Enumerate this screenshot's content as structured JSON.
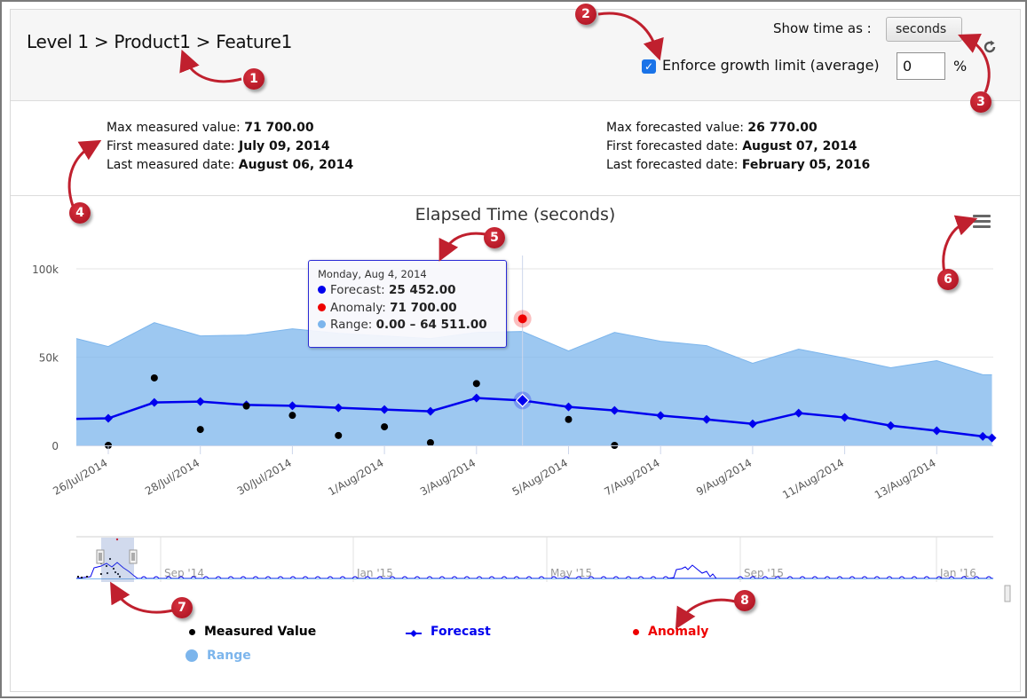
{
  "header": {
    "breadcrumb": [
      "Level 1",
      "Product1",
      "Feature1"
    ],
    "breadcrumb_separator": " > ",
    "show_time_label": "Show time as :",
    "time_unit_selected": "seconds",
    "refresh_icon": "refresh-icon",
    "growth_limit_checked": true,
    "growth_limit_label": "Enforce growth limit (average)",
    "growth_limit_value": "0",
    "percent_label": "%"
  },
  "stats": {
    "measured": [
      {
        "label": "Max measured value: ",
        "value": "71 700.00"
      },
      {
        "label": "First measured date: ",
        "value": "July 09, 2014"
      },
      {
        "label": "Last measured date: ",
        "value": "August 06, 2014"
      }
    ],
    "forecasted": [
      {
        "label": "Max forecasted value: ",
        "value": "26 770.00"
      },
      {
        "label": "First forecasted date: ",
        "value": "August 07, 2014"
      },
      {
        "label": "Last forecasted date: ",
        "value": "February 05, 2016"
      }
    ]
  },
  "tooltip": {
    "date": "Monday, Aug 4, 2014",
    "rows": [
      {
        "name": "Forecast",
        "value": "25 452.00",
        "color": "#0000ee"
      },
      {
        "name": "Anomaly",
        "value": "71 700.00",
        "color": "#ee0000"
      },
      {
        "name": "Range",
        "value": "0.00 – 64 511.00",
        "color": "#7cb5ec"
      }
    ]
  },
  "colors": {
    "range": "#7cb5ec",
    "forecast": "#0000ee",
    "measured": "#000000",
    "anomaly": "#ee0000"
  },
  "annotations": [
    "1",
    "2",
    "3",
    "4",
    "5",
    "6",
    "7",
    "8"
  ],
  "chart_data": {
    "type": "area",
    "title": "Elapsed Time (seconds)",
    "xlabel": "",
    "ylabel": "",
    "ylim": [
      0,
      100000
    ],
    "yticks": [
      0,
      50000,
      100000
    ],
    "ytick_labels": [
      "0",
      "50k",
      "100k"
    ],
    "grid": true,
    "x_start_day": -0.7,
    "x_end_day": 19.2,
    "xtick_days": [
      0,
      2,
      4,
      6,
      8,
      10,
      12,
      14,
      16,
      18
    ],
    "xtick_labels": [
      "26/Jul/2014",
      "28/Jul/2014",
      "30/Jul/2014",
      "1/Aug/2014",
      "3/Aug/2014",
      "5/Aug/2014",
      "7/Aug/2014",
      "9/Aug/2014",
      "11/Aug/2014",
      "13/Aug/2014"
    ],
    "x_day0": "2014-07-26",
    "series": [
      {
        "name": "Range",
        "kind": "arearange",
        "days": [
          -0.7,
          0,
          1,
          2,
          3,
          4,
          5,
          6,
          7,
          8,
          9,
          10,
          11,
          12,
          13,
          14,
          15,
          16,
          17,
          18,
          19,
          19.2
        ],
        "low": [
          0,
          0,
          0,
          0,
          0,
          0,
          0,
          0,
          0,
          0,
          0,
          0,
          0,
          0,
          0,
          0,
          0,
          0,
          0,
          0,
          0,
          0
        ],
        "high": [
          60500,
          56000,
          69500,
          62000,
          62500,
          66000,
          63500,
          62000,
          60500,
          64000,
          64511,
          53500,
          64000,
          59000,
          56500,
          46500,
          54500,
          49500,
          44000,
          48000,
          40000,
          40000
        ]
      },
      {
        "name": "Forecast",
        "kind": "line",
        "days": [
          -0.7,
          0,
          1,
          2,
          3,
          4,
          5,
          6,
          7,
          8,
          9,
          10,
          11,
          12,
          13,
          14,
          15,
          16,
          17,
          18,
          19,
          19.2
        ],
        "values": [
          15000,
          15300,
          24300,
          24800,
          22900,
          22400,
          21300,
          20300,
          19300,
          26800,
          25452,
          21800,
          19800,
          16900,
          14700,
          12200,
          18300,
          15800,
          11200,
          8300,
          5100,
          4200
        ]
      },
      {
        "name": "Measured Value",
        "kind": "scatter",
        "days": [
          0,
          1,
          2,
          3,
          4,
          5,
          6,
          7,
          8,
          10,
          11
        ],
        "values": [
          0,
          38200,
          9000,
          22300,
          17000,
          5600,
          10500,
          1500,
          35000,
          14700,
          0
        ]
      },
      {
        "name": "Anomaly",
        "kind": "scatter",
        "days": [
          9
        ],
        "values": [
          71700
        ]
      }
    ],
    "legend": [
      {
        "name": "Measured Value",
        "symbol": "dot",
        "color": "#000000"
      },
      {
        "name": "Forecast",
        "symbol": "line-diamond",
        "color": "#0000ee"
      },
      {
        "name": "Anomaly",
        "symbol": "dot",
        "color": "#ee0000"
      },
      {
        "name": "Range",
        "symbol": "big-dot",
        "color": "#7cb5ec"
      }
    ],
    "legend_position": "bottom",
    "navigator": {
      "labels": [
        "Sep '14",
        "Jan '15",
        "May '15",
        "Sep '15",
        "Jan '16"
      ],
      "selected_range": [
        "2014-07-25",
        "2014-08-14"
      ]
    }
  }
}
